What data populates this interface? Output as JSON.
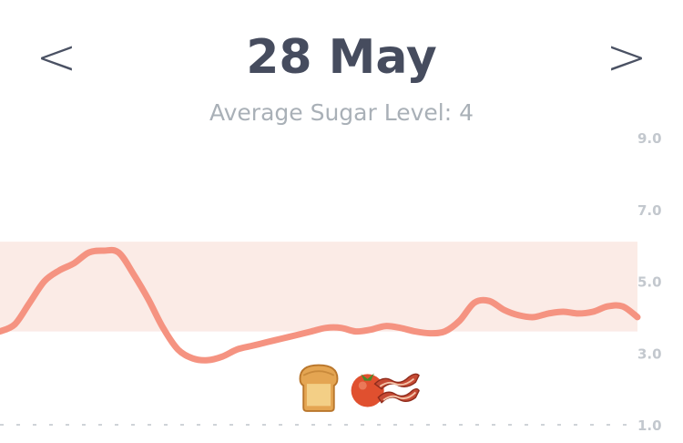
{
  "header": {
    "prev_label": "<",
    "next_label": ">",
    "date": "28 May",
    "average_label": "Average Sugar Level:",
    "average_value": "4"
  },
  "colors": {
    "title": "#464c5e",
    "subtitle": "#a9b0b7",
    "line": "#f59381",
    "target_band": "#fbebe6",
    "tick": "#c3c8ce"
  },
  "meal_icons": [
    "bread-icon",
    "tomato-icon",
    "bacon-icon"
  ],
  "chart_data": {
    "type": "line",
    "title": "",
    "xlabel": "",
    "ylabel": "",
    "ylim": [
      1.0,
      9.0
    ],
    "y_ticks": [
      "9.0",
      "7.0",
      "5.0",
      "3.0",
      "1.0"
    ],
    "y_tick_values": [
      9.0,
      7.0,
      5.0,
      3.0,
      1.0
    ],
    "y_axis_position": "right",
    "grid": false,
    "baseline": "dashed",
    "target_range": [
      3.6,
      6.1
    ],
    "series": [
      {
        "values": [
          3.6,
          3.8,
          4.4,
          5.0,
          5.3,
          5.5,
          5.8,
          5.85,
          5.8,
          5.2,
          4.5,
          3.7,
          3.1,
          2.85,
          2.8,
          2.9,
          3.1,
          3.2,
          3.3,
          3.4,
          3.5,
          3.6,
          3.7,
          3.7,
          3.6,
          3.65,
          3.75,
          3.7,
          3.6,
          3.55,
          3.6,
          3.9,
          4.4,
          4.45,
          4.2,
          4.05,
          4.0,
          4.1,
          4.15,
          4.1,
          4.15,
          4.3,
          4.3,
          4.0
        ]
      }
    ]
  }
}
